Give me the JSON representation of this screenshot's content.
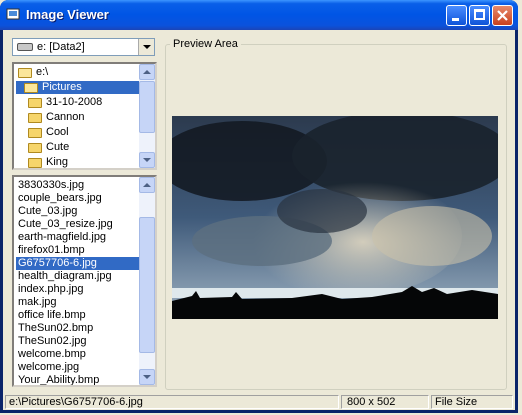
{
  "window": {
    "title": "Image Viewer"
  },
  "titlebar": {
    "icons": {
      "app": "image-viewer-app-icon",
      "minimize": "minimize-icon",
      "maximize": "maximize-icon",
      "close": "close-icon"
    }
  },
  "drive": {
    "value": "e: [Data2]",
    "icon": "drive-icon"
  },
  "dirs": {
    "items": [
      "e:\\",
      "Pictures",
      "31-10-2008",
      "Cannon",
      "Cool",
      "Cute",
      "King"
    ],
    "selected": "Pictures"
  },
  "files": {
    "items": [
      "3830330s.jpg",
      "couple_bears.jpg",
      "Cute_03.jpg",
      "Cute_03_resize.jpg",
      "earth-magfield.jpg",
      "firefox01.bmp",
      "G6757706-6.jpg",
      "health_diagram.jpg",
      "index.php.jpg",
      "mak.jpg",
      "office life.bmp",
      "TheSun02.bmp",
      "TheSun02.jpg",
      "welcome.bmp",
      "welcome.jpg",
      "Your_Ability.bmp"
    ],
    "selected": "G6757706-6.jpg"
  },
  "preview": {
    "label": "Preview Area",
    "image": "stormy-sky-photo"
  },
  "status": {
    "path": "e:\\Pictures\\G6757706-6.jpg",
    "dimensions": "800 x 502",
    "size": "File Size"
  },
  "colors": {
    "title_bar": "#0055e5",
    "selection": "#316ac5",
    "window_face": "#ece9d8"
  }
}
